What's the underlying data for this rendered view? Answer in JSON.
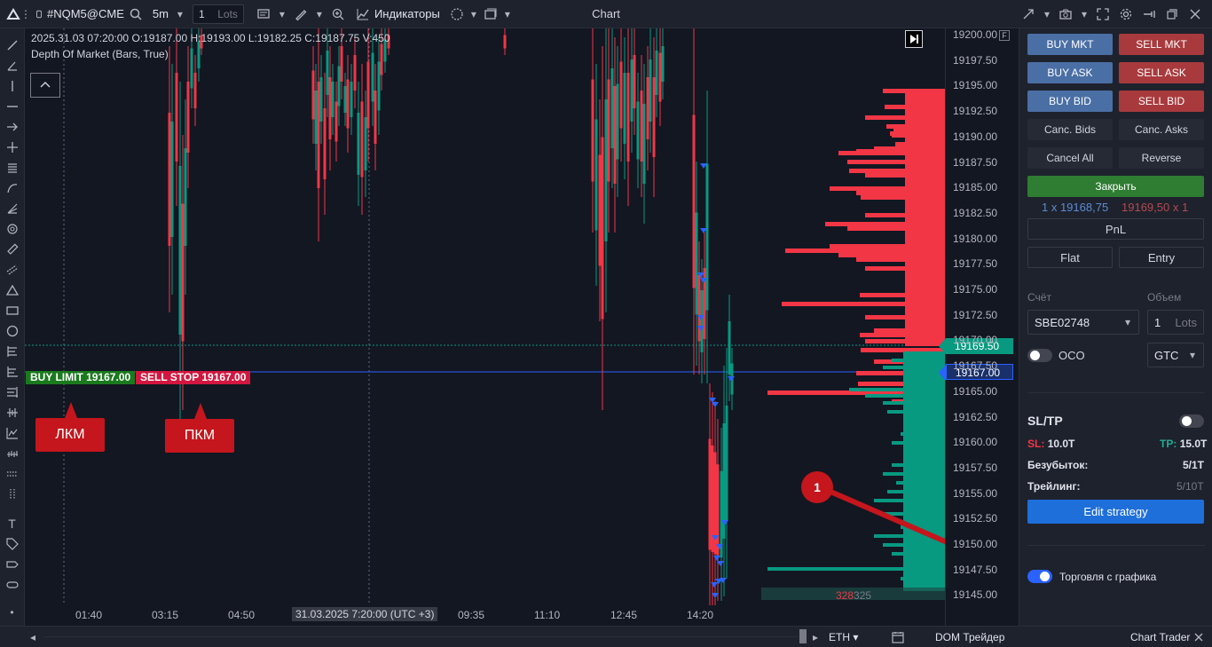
{
  "window": {
    "title": "Chart"
  },
  "toolbar": {
    "symbol": "#NQM5@CME",
    "timeframe": "5m",
    "quantity": "1",
    "quantity_unit": "Lots",
    "indicators_label": "Индикаторы"
  },
  "chart": {
    "ohlc_line": "2025.31.03 07:20:00 O:19187.00 H:19193.00 L:19182.25 C:19187.75 V:450",
    "indicator_line": "Depth Of Market (Bars, True)",
    "buy_limit_label": "BUY LIMIT 19167.00",
    "sell_stop_label": "SELL STOP 19167.00",
    "callout_left": "ЛКМ",
    "callout_right": "ПКМ",
    "badge_number": "1",
    "volume_ask": "328",
    "volume_bid": "325",
    "crosshair_date": "31.03.2025 7:20:00 (UTC +3)",
    "time_ticks": [
      "01:40",
      "03:15",
      "04:50",
      "09:35",
      "11:10",
      "12:45",
      "14:20"
    ],
    "price_labels": [
      "19200.00",
      "19197.50",
      "19195.00",
      "19192.50",
      "19190.00",
      "19187.50",
      "19185.00",
      "19182.50",
      "19180.00",
      "19177.50",
      "19175.00",
      "19172.50",
      "19170.00",
      "19167.50",
      "19165.00",
      "19162.50",
      "19160.00",
      "19157.50",
      "19155.00",
      "19152.50",
      "19150.00",
      "19147.50",
      "19145.00"
    ],
    "last_price_tag": "19169.50",
    "order_price_tag": "19167.00",
    "colors": {
      "up": "#089981",
      "down": "#f23645",
      "ask_profile": "#f23645",
      "bid_profile": "#089981"
    }
  },
  "trader_panel": {
    "buy_mkt": "BUY MKT",
    "sell_mkt": "SELL MKT",
    "buy_ask": "BUY ASK",
    "sell_ask": "SELL ASK",
    "buy_bid": "BUY BID",
    "sell_bid": "SELL BID",
    "canc_bids": "Canc. Bids",
    "canc_asks": "Canc. Asks",
    "cancel_all": "Cancel All",
    "reverse": "Reverse",
    "close": "Закрыть",
    "bid_quote": "1 x 19168,75",
    "ask_quote": "19169,50 x 1",
    "pnl": "PnL",
    "flat": "Flat",
    "entry": "Entry",
    "account_label": "Счёт",
    "volume_label": "Объем",
    "account": "SBE02748",
    "volume_value": "1",
    "volume_unit": "Lots",
    "oco": "OCO",
    "tif": "GTC",
    "sltp_title": "SL/TP",
    "sl_label": "SL:",
    "sl_value": "10.0T",
    "tp_label": "TP:",
    "tp_value": "15.0T",
    "breakeven_label": "Безубыток:",
    "breakeven_value": "5/1T",
    "trailing_label": "Трейлинг:",
    "trailing_value": "5/10T",
    "edit_strategy": "Edit strategy",
    "chart_trading_label": "Торговля с графика",
    "chart_trading_on": true
  },
  "bottom": {
    "session": "ETH",
    "dom": "DOM Трейдер",
    "chart_trader": "Chart Trader"
  }
}
